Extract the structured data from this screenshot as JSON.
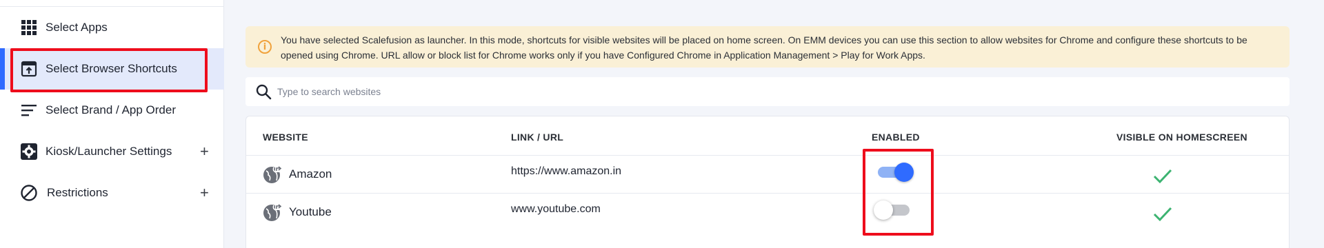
{
  "sidebar": {
    "items": [
      {
        "label": "Select Apps",
        "icon": "grid-icon",
        "expandable": false,
        "active": false
      },
      {
        "label": "Select Browser Shortcuts",
        "icon": "browser-shortcut-icon",
        "expandable": false,
        "active": true
      },
      {
        "label": "Select Brand / App Order",
        "icon": "sort-lines-icon",
        "expandable": false,
        "active": false
      },
      {
        "label": "Kiosk/Launcher Settings",
        "icon": "gear-icon",
        "expandable": true,
        "active": false
      },
      {
        "label": "Restrictions",
        "icon": "block-icon",
        "expandable": true,
        "active": false
      }
    ],
    "expand_symbol": "+"
  },
  "alert": {
    "icon": "info-icon",
    "icon_glyph": "i",
    "text": "You have selected Scalefusion as launcher. In this mode, shortcuts for visible websites will be placed on home screen. On EMM devices you can use this section to allow websites for Chrome and configure these shortcuts to be opened using Chrome. URL allow or block list for Chrome works only if you have Configured Chrome in Application Management > Play for Work Apps."
  },
  "search": {
    "placeholder": "Type to search websites",
    "value": ""
  },
  "table": {
    "headers": {
      "website": "WEBSITE",
      "link": "LINK / URL",
      "enabled": "ENABLED",
      "visible": "VISIBLE ON HOMESCREEN"
    },
    "rows": [
      {
        "website": "Amazon",
        "url": "https://www.amazon.in",
        "enabled": true,
        "visible_on_homescreen": true
      },
      {
        "website": "Youtube",
        "url": "www.youtube.com",
        "enabled": false,
        "visible_on_homescreen": true
      }
    ]
  },
  "colors": {
    "accent": "#2f6bff",
    "highlight_box": "#ee0d1c",
    "alert_bg": "#faf0d6",
    "alert_icon": "#f0a23c",
    "check": "#3cb371"
  }
}
